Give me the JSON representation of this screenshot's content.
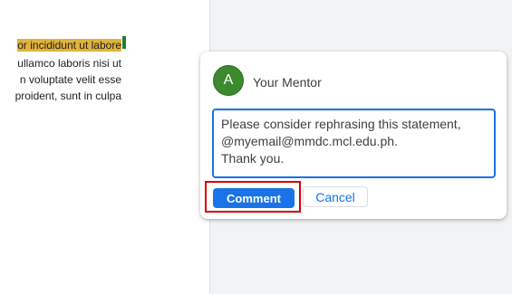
{
  "document": {
    "lines": [
      "or incididunt ut labore",
      "ullamco laboris nisi ut",
      "n voluptate velit esse",
      "proident, sunt in culpa"
    ]
  },
  "comment": {
    "avatar_letter": "A",
    "author": "Your Mentor",
    "reply_lines": [
      "Please consider rephrasing this statement,",
      "@myemail@mmdc.mcl.edu.ph.",
      "Thank you."
    ],
    "submit_label": "Comment",
    "cancel_label": "Cancel"
  },
  "colors": {
    "highlight": "#e2b33a",
    "accent": "#1a73e8",
    "avatar": "#3b8a2e",
    "annotation_outline": "#d50000"
  }
}
